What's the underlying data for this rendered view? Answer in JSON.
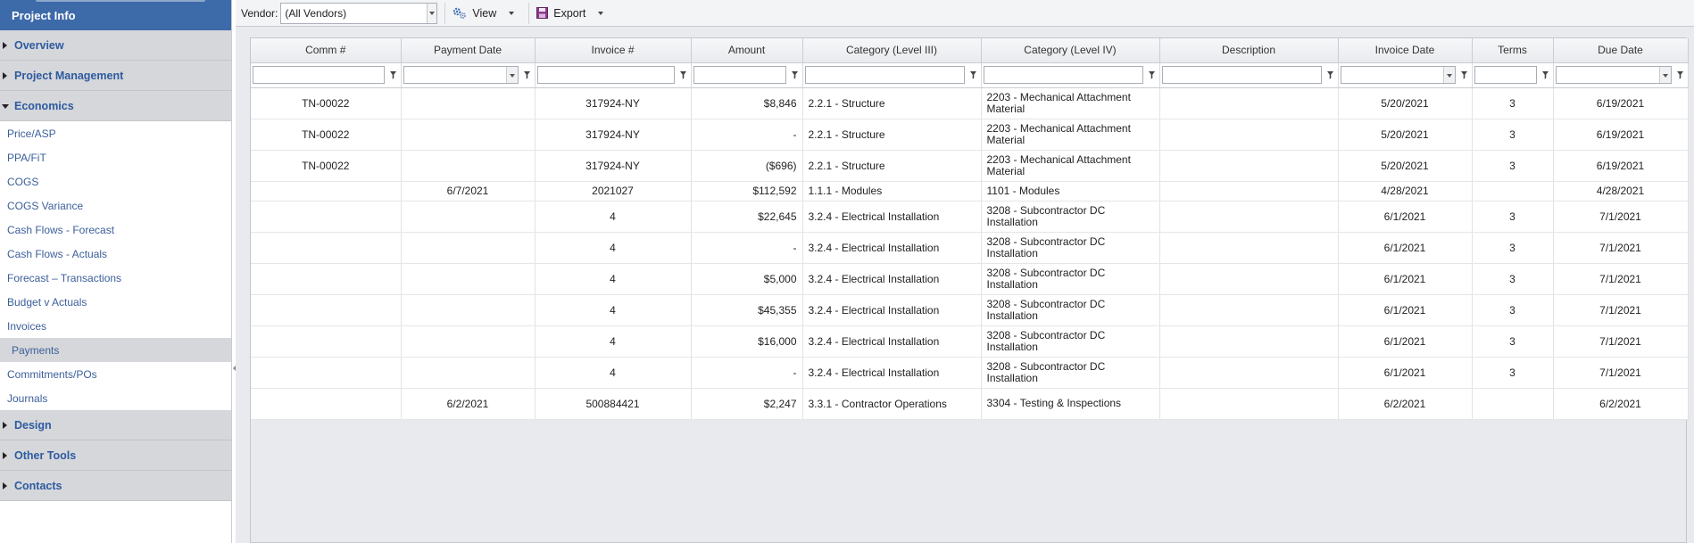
{
  "sidebar": {
    "header": "Project Info",
    "sections_top": [
      "Overview",
      "Project Management",
      "Economics"
    ],
    "economics_items": [
      "Price/ASP",
      "PPA/FiT",
      "COGS",
      "COGS Variance",
      "Cash Flows - Forecast",
      "Cash Flows - Actuals",
      "Forecast – Transactions",
      "Budget v Actuals",
      "Invoices",
      "Payments",
      "Commitments/POs",
      "Journals"
    ],
    "active_item": "Payments",
    "sections_bottom": [
      "Design",
      "Other Tools",
      "Contacts"
    ]
  },
  "toolbar": {
    "vendor_label": "Vendor:",
    "vendor_value": "(All Vendors)",
    "view_label": "View",
    "export_label": "Export"
  },
  "grid": {
    "columns": [
      "Comm #",
      "Payment Date",
      "Invoice #",
      "Amount",
      "Category (Level III)",
      "Category (Level IV)",
      "Description",
      "Invoice Date",
      "Terms",
      "Due Date"
    ],
    "rows": [
      [
        "TN-00022",
        "",
        "317924-NY",
        "$8,846",
        "2.2.1 - Structure",
        "2203 - Mechanical Attachment Material",
        "",
        "5/20/2021",
        "3",
        "6/19/2021"
      ],
      [
        "TN-00022",
        "",
        "317924-NY",
        "-",
        "2.2.1 - Structure",
        "2203 - Mechanical Attachment Material",
        "",
        "5/20/2021",
        "3",
        "6/19/2021"
      ],
      [
        "TN-00022",
        "",
        "317924-NY",
        "($696)",
        "2.2.1 - Structure",
        "2203 - Mechanical Attachment Material",
        "",
        "5/20/2021",
        "3",
        "6/19/2021"
      ],
      [
        "",
        "6/7/2021",
        "2021027",
        "$112,592",
        "1.1.1 - Modules",
        "1101 - Modules",
        "",
        "4/28/2021",
        "",
        "4/28/2021"
      ],
      [
        "",
        "",
        "4",
        "$22,645",
        "3.2.4 - Electrical Installation",
        "3208 - Subcontractor DC Installation",
        "",
        "6/1/2021",
        "3",
        "7/1/2021"
      ],
      [
        "",
        "",
        "4",
        "-",
        "3.2.4 - Electrical Installation",
        "3208 - Subcontractor DC Installation",
        "",
        "6/1/2021",
        "3",
        "7/1/2021"
      ],
      [
        "",
        "",
        "4",
        "$5,000",
        "3.2.4 - Electrical Installation",
        "3208 - Subcontractor DC Installation",
        "",
        "6/1/2021",
        "3",
        "7/1/2021"
      ],
      [
        "",
        "",
        "4",
        "$45,355",
        "3.2.4 - Electrical Installation",
        "3208 - Subcontractor DC Installation",
        "",
        "6/1/2021",
        "3",
        "7/1/2021"
      ],
      [
        "",
        "",
        "4",
        "$16,000",
        "3.2.4 - Electrical Installation",
        "3208 - Subcontractor DC Installation",
        "",
        "6/1/2021",
        "3",
        "7/1/2021"
      ],
      [
        "",
        "",
        "4",
        "-",
        "3.2.4 - Electrical Installation",
        "3208 - Subcontractor DC Installation",
        "",
        "6/1/2021",
        "3",
        "7/1/2021"
      ],
      [
        "",
        "6/2/2021",
        "500884421",
        "$2,247",
        "3.3.1 - Contractor Operations",
        "3304 - Testing & Inspections",
        "",
        "6/2/2021",
        "",
        "6/2/2021"
      ]
    ]
  },
  "icons": {
    "filter": "filter-icon",
    "view": "gears-icon",
    "export": "export-icon",
    "dropdown": "chevron-down-icon"
  },
  "colors": {
    "sidebar_header": "#3d6aa8",
    "section_bg": "#d5d7da",
    "link": "#3b5f99"
  }
}
